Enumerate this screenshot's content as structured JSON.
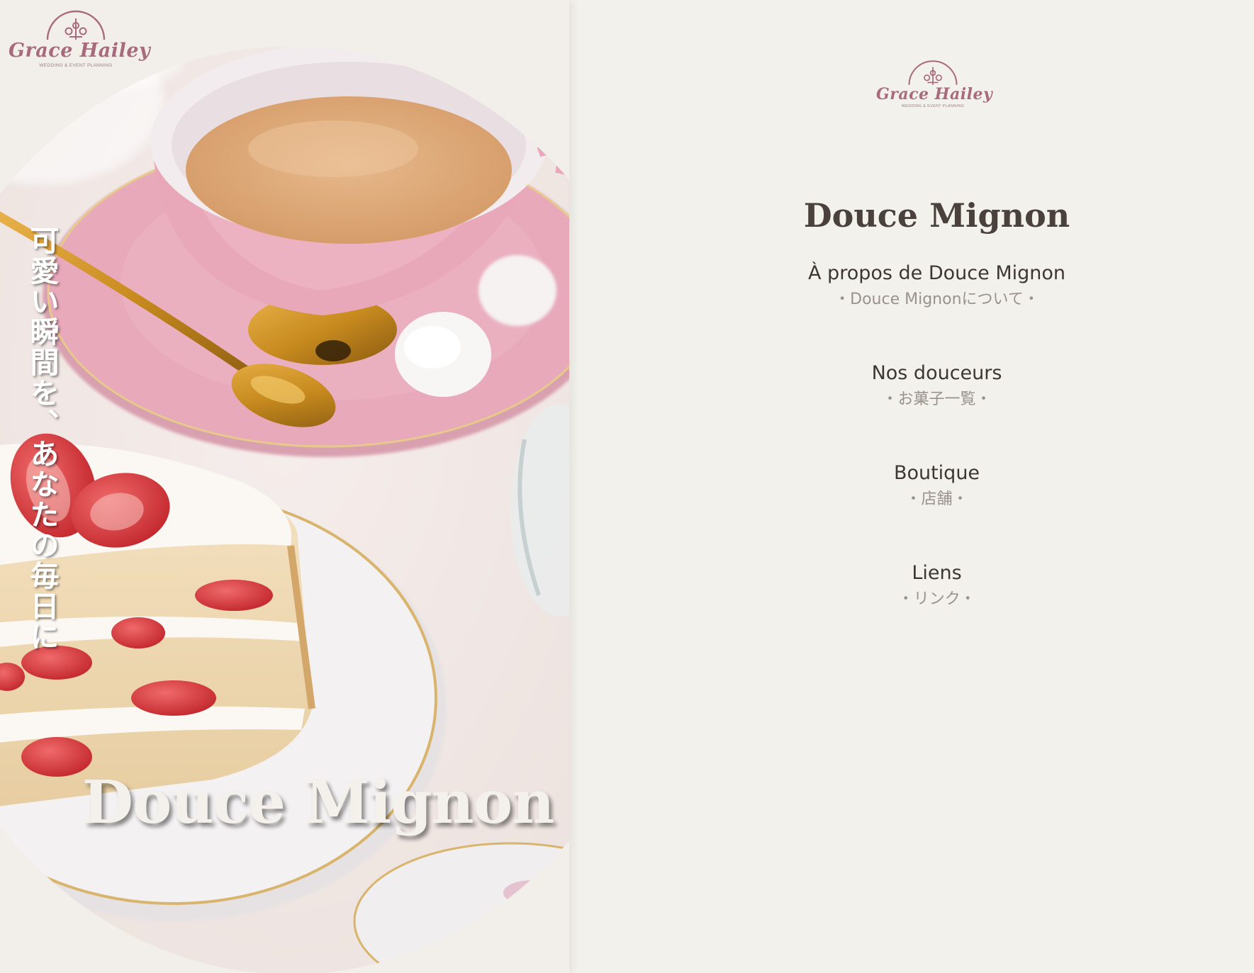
{
  "brand": {
    "name": "Grace Hailey",
    "subtitle": "WEDDING & EVENT PLANNING",
    "color": "#a86a7d"
  },
  "hero": {
    "tagline": "可愛い瞬間を、あなたの毎日に",
    "title": "Douce Mignon"
  },
  "nav": {
    "title": "Douce Mignon",
    "items": [
      {
        "label": "À propos de Douce Mignon",
        "sub": "・Douce Mignonについて・"
      },
      {
        "label": "Nos douceurs",
        "sub": "・お菓子一覧・"
      },
      {
        "label": "Boutique",
        "sub": "・店舗・"
      },
      {
        "label": "Liens",
        "sub": "・リンク・"
      }
    ]
  },
  "colors": {
    "background": "#f3f1ec",
    "heading": "#4a403c",
    "nav_label": "#3d3633",
    "nav_sub": "#9b918c",
    "saucer_pink": "#e8a9bb",
    "tea": "#dba877",
    "strawberry": "#d8383c"
  }
}
